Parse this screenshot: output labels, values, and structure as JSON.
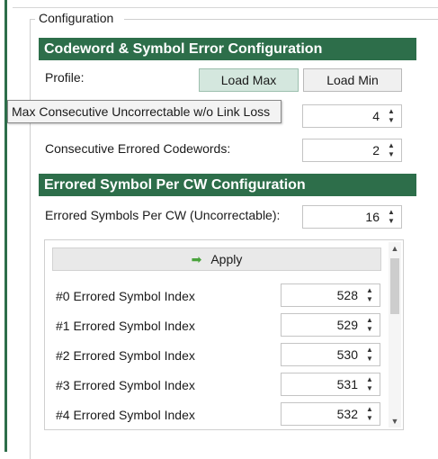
{
  "group": {
    "legend": "Configuration"
  },
  "codeword_section": {
    "header": "Codeword & Symbol Error Configuration",
    "profile_label": "Profile:",
    "load_max_label": "Load Max",
    "load_min_label": "Load Min",
    "tooltip_text": "Max Consecutive Uncorrectable w/o Link Loss",
    "max_consecutive_value": "4",
    "consecutive_errored_label": "Consecutive Errored Codewords:",
    "consecutive_errored_value": "2"
  },
  "symbol_section": {
    "header": "Errored Symbol Per CW Configuration",
    "errored_symbols_label": "Errored Symbols Per CW (Uncorrectable):",
    "errored_symbols_value": "16"
  },
  "list": {
    "apply_label": "Apply",
    "rows": [
      {
        "label": "#0 Errored Symbol Index",
        "value": "528"
      },
      {
        "label": "#1 Errored Symbol Index",
        "value": "529"
      },
      {
        "label": "#2 Errored Symbol Index",
        "value": "530"
      },
      {
        "label": "#3 Errored Symbol Index",
        "value": "531"
      },
      {
        "label": "#4 Errored Symbol Index",
        "value": "532"
      }
    ]
  },
  "icons": {
    "spin_up": "▲",
    "spin_down": "▼",
    "apply_arrow": "➡",
    "scroll_up": "▲",
    "scroll_down": "▼"
  },
  "colors": {
    "accent": "#2d6e4a",
    "active_button": "#d4e7de",
    "apply_arrow": "#4aa33d"
  }
}
